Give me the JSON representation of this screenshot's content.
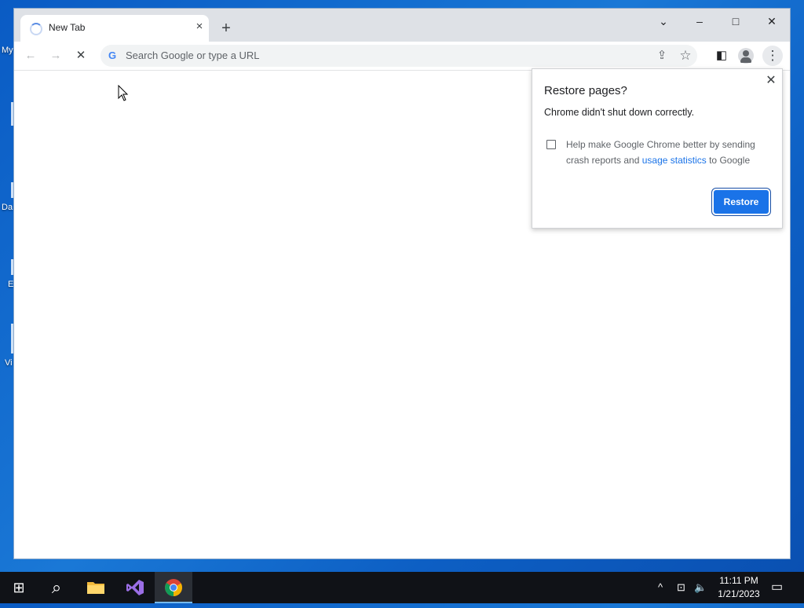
{
  "desktop": {
    "icon_labels": [
      "My",
      "Da",
      "E",
      "Vi"
    ]
  },
  "browser": {
    "tab": {
      "title": "New Tab",
      "close_icon": "×"
    },
    "new_tab_icon": "+",
    "window_controls": {
      "tab_search": "⌄",
      "minimize": "–",
      "maximize": "□",
      "close": "✕"
    },
    "toolbar": {
      "back": "←",
      "forward": "→",
      "stop": "✕",
      "google_icon": "G",
      "omnibox_placeholder": "Search Google or type a URL",
      "share": "⇪",
      "bookmark": "☆",
      "side_panel": "◧",
      "menu": "⋮"
    }
  },
  "restore_dialog": {
    "title": "Restore pages?",
    "close_icon": "✕",
    "message": "Chrome didn't shut down correctly.",
    "checkbox_text_before": "Help make Google Chrome better by sending crash reports and ",
    "checkbox_link": "usage statistics",
    "checkbox_text_after": " to Google",
    "checkbox_checked": false,
    "restore_button": "Restore"
  },
  "taskbar": {
    "start_icon": "⊞",
    "search_icon": "⌕",
    "tray": {
      "chevron": "^",
      "network": "⊡",
      "volume": "🔈"
    },
    "time": "11:11 PM",
    "date": "1/21/2023",
    "notifications_icon": "▭"
  },
  "colors": {
    "accent": "#1a73e8",
    "desktop": "#0a5bc4",
    "taskbar": "#101217"
  }
}
